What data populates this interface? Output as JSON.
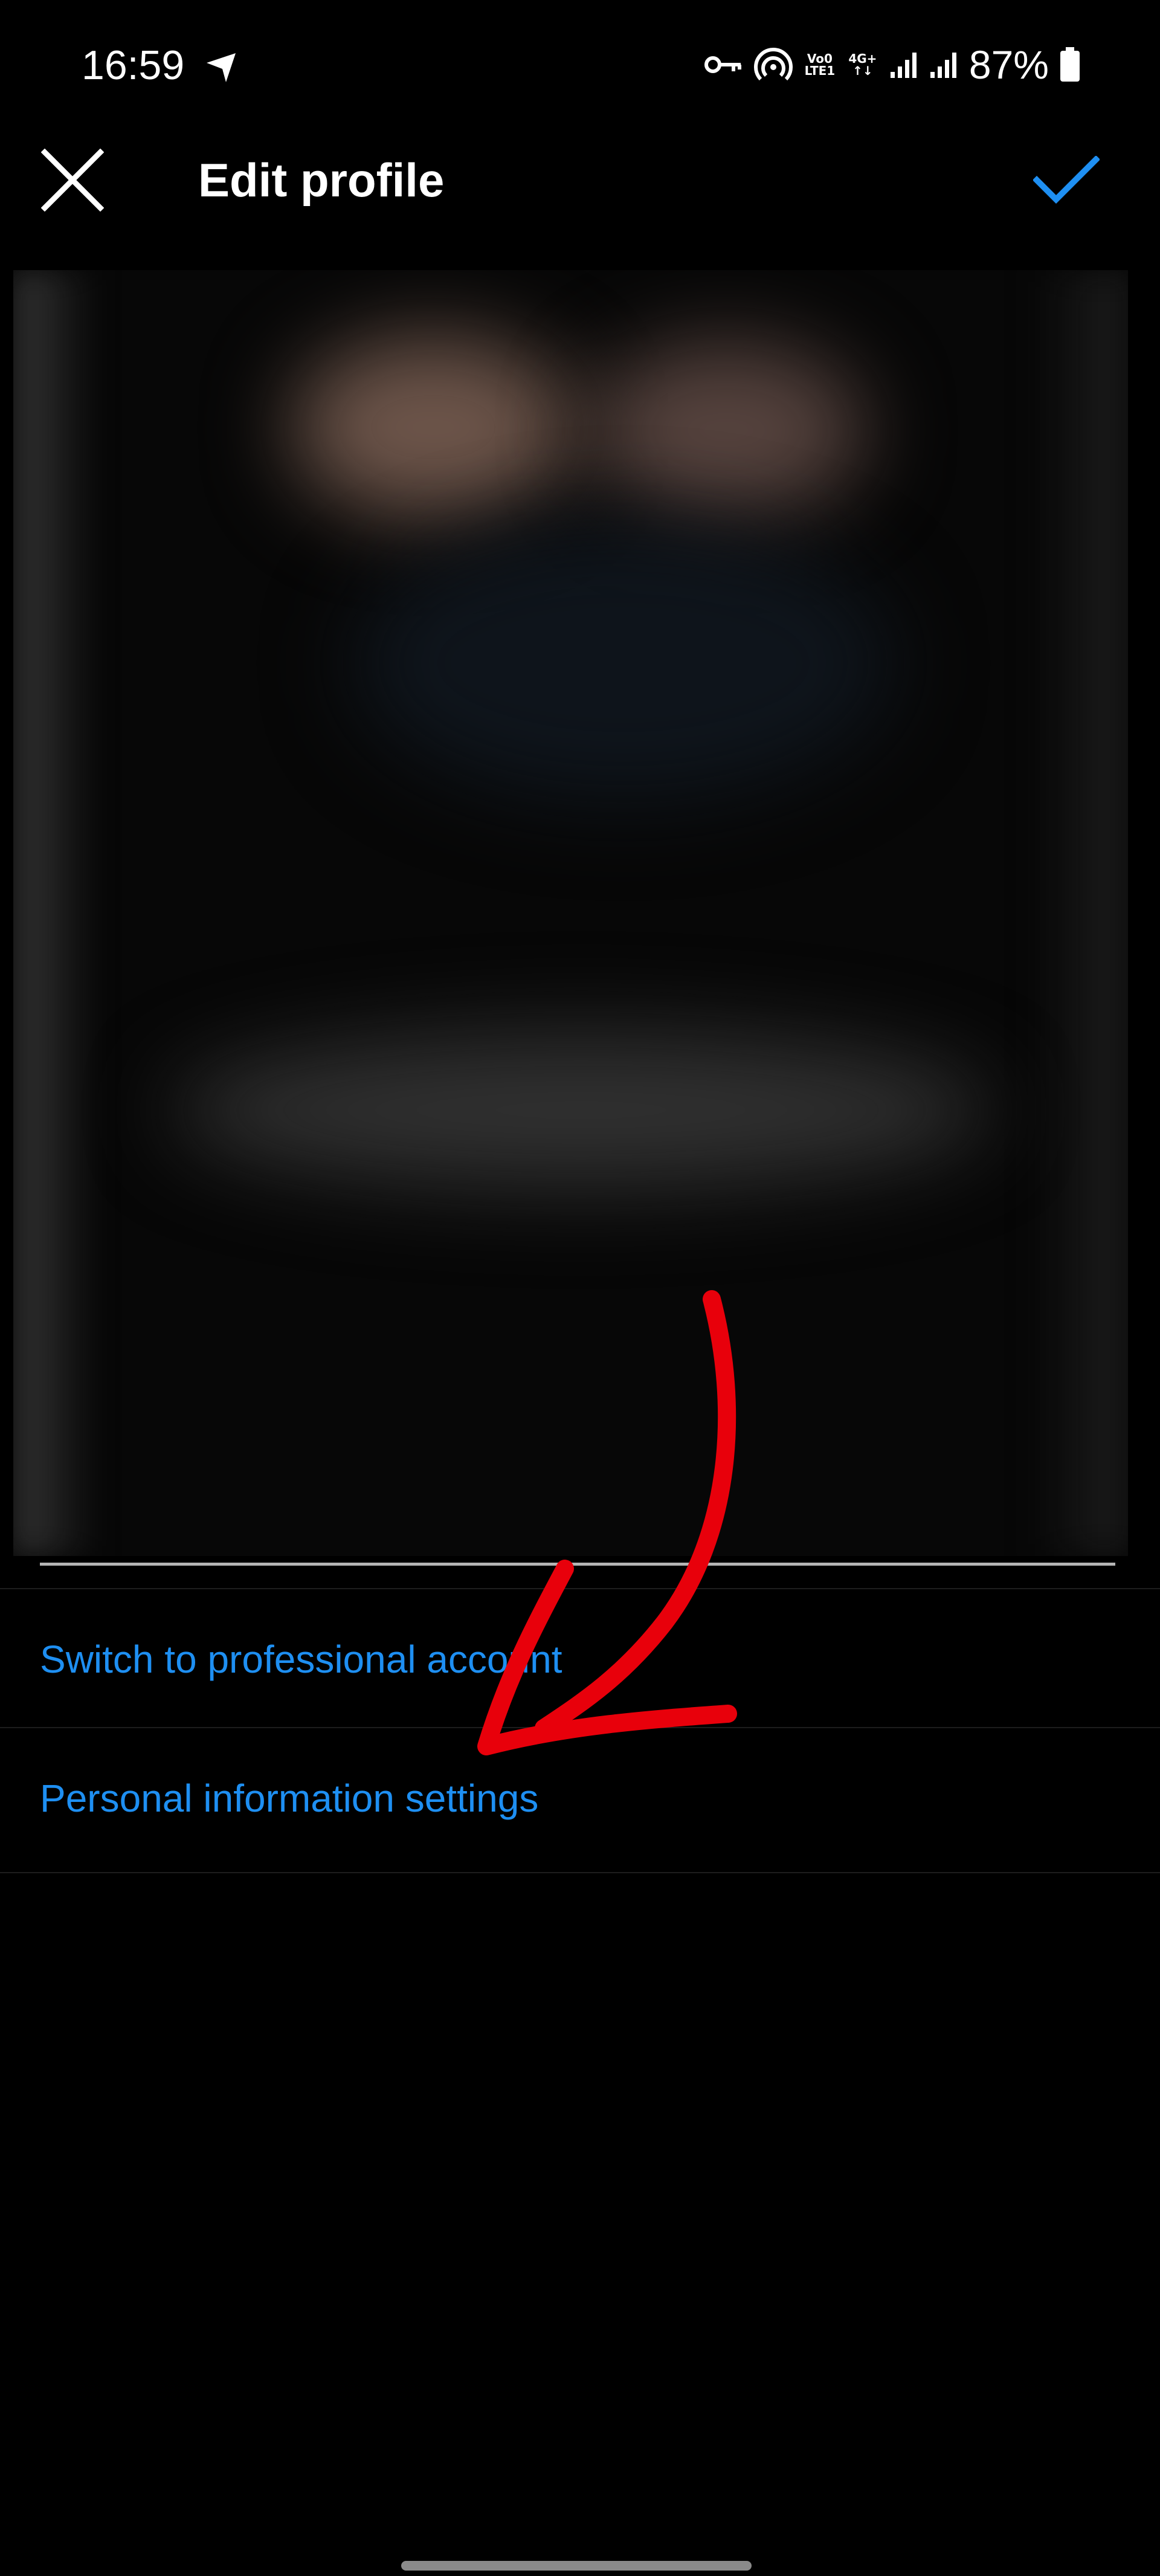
{
  "status_bar": {
    "time": "16:59",
    "battery": "87%",
    "net_volte": "Vo0",
    "net_lte": "LTE1",
    "net_4g": "4G+",
    "net_arrows": "↑↓",
    "icons": [
      "navigation-arrow-icon",
      "vpn-key-icon",
      "hotspot-icon",
      "signal-icon",
      "signal-icon",
      "battery-icon"
    ]
  },
  "header": {
    "title": "Edit profile",
    "close_icon": "close-icon",
    "confirm_icon": "checkmark-icon"
  },
  "menu": {
    "items": [
      {
        "label": "Switch to professional account"
      },
      {
        "label": "Personal information settings"
      }
    ]
  },
  "colors": {
    "background": "#000000",
    "link_blue": "#1e8ff2",
    "annotation_red": "#e8000b",
    "divider": "#1d1d1d"
  }
}
